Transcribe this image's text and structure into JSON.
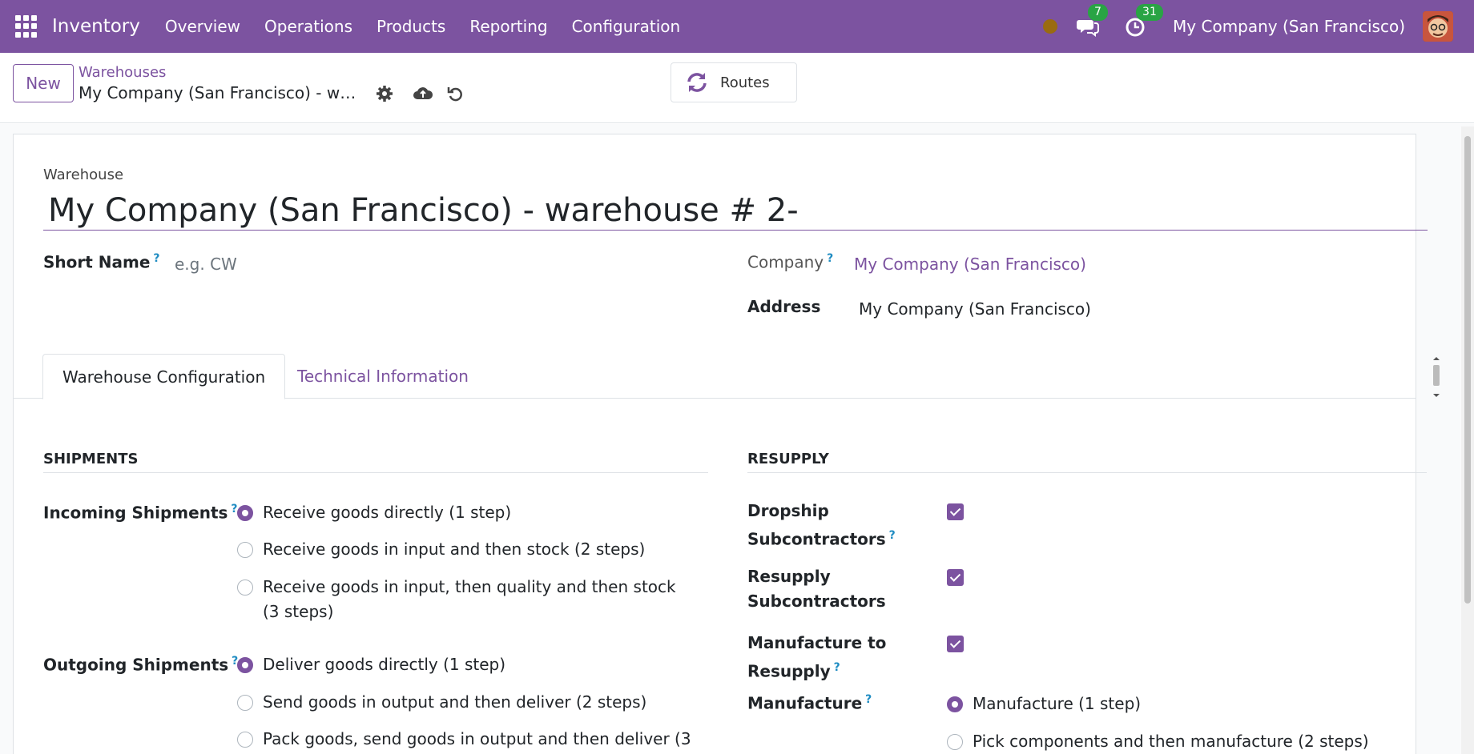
{
  "navbar": {
    "app_name": "Inventory",
    "menu": [
      "Overview",
      "Operations",
      "Products",
      "Reporting",
      "Configuration"
    ],
    "messages_count": "7",
    "activities_count": "31",
    "company": "My Company (San Francisco)"
  },
  "control_panel": {
    "new_label": "New",
    "breadcrumb": "Warehouses",
    "record_title": "My Company (San Francisco) - warehouse # 2-",
    "routes_label": "Routes"
  },
  "form": {
    "warehouse_label": "Warehouse",
    "warehouse_name": "My Company (San Francisco) - warehouse # 2-",
    "short_name_label": "Short Name",
    "short_name_placeholder": "e.g. CW",
    "company_label": "Company",
    "company_value": "My Company (San Francisco)",
    "address_label": "Address",
    "address_value": "My Company (San Francisco)",
    "help_mark": "?"
  },
  "tabs": {
    "config": "Warehouse Configuration",
    "technical": "Technical Information"
  },
  "shipments": {
    "title": "SHIPMENTS",
    "incoming_label": "Incoming Shipments",
    "incoming_options": [
      "Receive goods directly (1 step)",
      "Receive goods in input and then stock (2 steps)",
      "Receive goods in input, then quality and then stock (3 steps)"
    ],
    "incoming_selected": 0,
    "outgoing_label": "Outgoing Shipments",
    "outgoing_options": [
      "Deliver goods directly (1 step)",
      "Send goods in output and then deliver (2 steps)",
      "Pack goods, send goods in output and then deliver (3"
    ],
    "outgoing_selected": 0
  },
  "resupply": {
    "title": "RESUPPLY",
    "dropship_label": "Dropship Subcontractors",
    "dropship_checked": true,
    "resupply_label": "Resupply Subcontractors",
    "resupply_checked": true,
    "mto_label": "Manufacture to Resupply",
    "mto_checked": true,
    "manufacture_label": "Manufacture",
    "manufacture_options": [
      "Manufacture (1 step)",
      "Pick components and then manufacture (2 steps)"
    ],
    "manufacture_selected": 0
  },
  "colors": {
    "brand": "#7c53a0",
    "badge": "#29a444",
    "help": "#1f8cc2"
  }
}
